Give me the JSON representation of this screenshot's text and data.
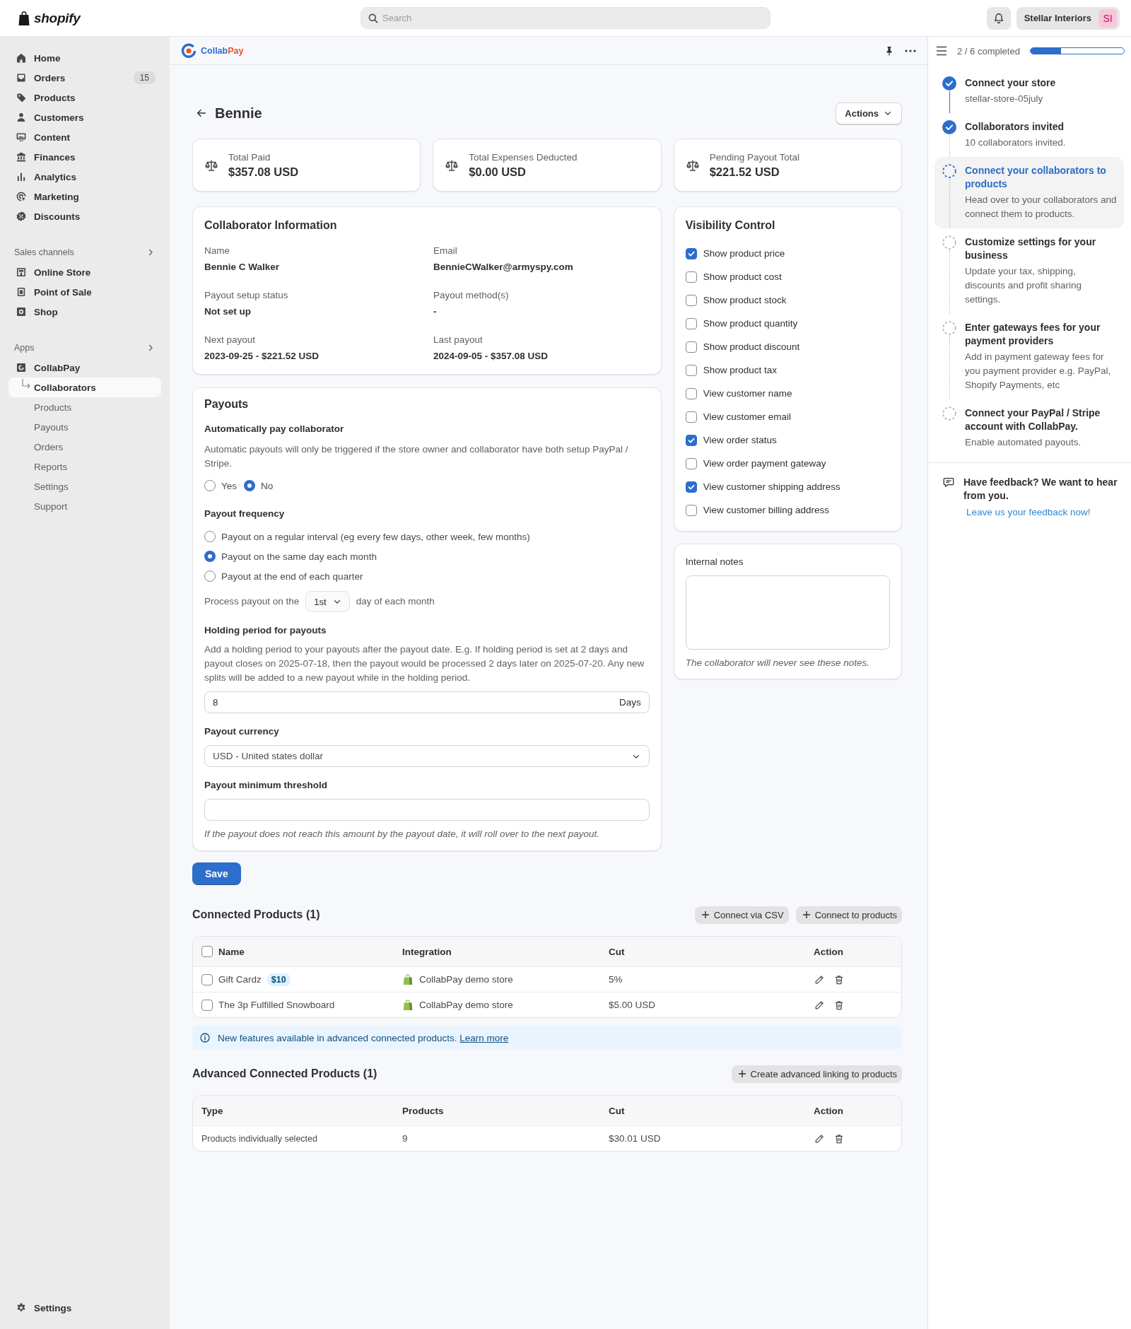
{
  "topbar": {
    "logo_text": "shopify",
    "search": {
      "placeholder": "Search"
    },
    "store": {
      "name": "Stellar Interiors",
      "initials": "SI"
    }
  },
  "sidebar": {
    "items": [
      {
        "label": "Home",
        "selected": false
      },
      {
        "label": "Orders",
        "badge": "15",
        "selected": false
      },
      {
        "label": "Products",
        "selected": false
      },
      {
        "label": "Customers",
        "selected": false
      },
      {
        "label": "Content",
        "selected": false
      },
      {
        "label": "Finances",
        "selected": false
      },
      {
        "label": "Analytics",
        "selected": false
      },
      {
        "label": "Marketing",
        "selected": false
      },
      {
        "label": "Discounts",
        "selected": false
      }
    ],
    "sales_channels": {
      "title": "Sales channels",
      "items": [
        {
          "label": "Online Store",
          "selected": false
        },
        {
          "label": "Point of Sale",
          "selected": false
        },
        {
          "label": "Shop",
          "selected": false
        }
      ]
    },
    "apps": {
      "title": "Apps",
      "items": [
        {
          "label": "CollabPay",
          "selected": false,
          "children": [
            {
              "label": "Collaborators",
              "selected": true
            },
            {
              "label": "Products",
              "selected": false
            },
            {
              "label": "Payouts",
              "selected": false
            },
            {
              "label": "Orders",
              "selected": false
            },
            {
              "label": "Reports",
              "selected": false
            },
            {
              "label": "Settings",
              "selected": false
            },
            {
              "label": "Support",
              "selected": false
            }
          ]
        }
      ]
    },
    "settings": {
      "label": "Settings"
    }
  },
  "app_header": {
    "brand": [
      "Collab",
      "Pay"
    ]
  },
  "page": {
    "title": "Bennie",
    "actions_button": "Actions",
    "stats": [
      {
        "label": "Total Paid",
        "value": "$357.08 USD"
      },
      {
        "label": "Total Expenses Deducted",
        "value": "$0.00 USD"
      },
      {
        "label": "Pending Payout Total",
        "value": "$221.52 USD"
      }
    ],
    "collaborator_info": {
      "title": "Collaborator Information",
      "fields": [
        {
          "label": "Name",
          "value": "Bennie C Walker"
        },
        {
          "label": "Email",
          "value": "BennieCWalker@armyspy.com"
        },
        {
          "label": "Payout setup status",
          "value": "Not set up"
        },
        {
          "label": "Payout method(s)",
          "value": "-"
        },
        {
          "label": "Next payout",
          "value": "2023-09-25 - $221.52 USD"
        },
        {
          "label": "Last payout",
          "value": "2024-09-05 - $357.08 USD"
        }
      ]
    },
    "payouts": {
      "title": "Payouts",
      "auto_pay": {
        "label": "Automatically pay collaborator",
        "help": "Automatic payouts will only be triggered if the store owner and collaborator have both setup PayPal / Stripe.",
        "options": [
          {
            "label": "Yes",
            "selected": false
          },
          {
            "label": "No",
            "selected": true
          }
        ]
      },
      "frequency": {
        "label": "Payout frequency",
        "options": [
          {
            "label": "Payout on a regular interval (eg every few days, other week, few months)",
            "selected": false
          },
          {
            "label": "Payout on the same day each month",
            "selected": true
          },
          {
            "label": "Payout at the end of each quarter",
            "selected": false
          }
        ],
        "process": {
          "prefix": "Process payout on the",
          "value": "1st",
          "suffix": "day of each month"
        }
      },
      "holding": {
        "label": "Holding period for payouts",
        "help": "Add a holding period to your payouts after the payout date. E.g. If holding period is set at 2 days and payout closes on 2025-07-18, then the payout would be processed 2 days later on 2025-07-20. Any new splits will be added to a new payout while in the holding period.",
        "value": "8",
        "unit": "Days"
      },
      "currency": {
        "label": "Payout currency",
        "value": "USD - United states dollar"
      },
      "threshold": {
        "label": "Payout minimum threshold",
        "help": "If the payout does not reach this amount by the payout date, it will roll over to the next payout."
      }
    },
    "save_button": "Save",
    "visibility": {
      "title": "Visibility Control",
      "options": [
        {
          "label": "Show product price",
          "checked": true
        },
        {
          "label": "Show product cost",
          "checked": false
        },
        {
          "label": "Show product stock",
          "checked": false
        },
        {
          "label": "Show product quantity",
          "checked": false
        },
        {
          "label": "Show product discount",
          "checked": false
        },
        {
          "label": "Show product tax",
          "checked": false
        },
        {
          "label": "View customer name",
          "checked": false
        },
        {
          "label": "View customer email",
          "checked": false
        },
        {
          "label": "View order status",
          "checked": true
        },
        {
          "label": "View order payment gateway",
          "checked": false
        },
        {
          "label": "View customer shipping address",
          "checked": true
        },
        {
          "label": "View customer billing address",
          "checked": false
        }
      ]
    },
    "internal_notes": {
      "label": "Internal notes",
      "help": "The collaborator will never see these notes."
    },
    "connected_products": {
      "title": "Connected Products (1)",
      "buttons": [
        "Connect via CSV",
        "Connect to products"
      ],
      "columns": [
        "Name",
        "Integration",
        "Cut",
        "Action"
      ],
      "select_all_checked": false,
      "rows": [
        {
          "checked": false,
          "name": "Gift Cardz",
          "badge": "$10",
          "integration": "CollabPay demo store",
          "cut": "5%"
        },
        {
          "checked": false,
          "name": "The 3p Fulfilled Snowboard",
          "integration": "CollabPay demo store",
          "cut": "$5.00 USD"
        }
      ]
    },
    "banner": {
      "text": "New features available in advanced connected products.",
      "link": "Learn more"
    },
    "advanced_products": {
      "title": "Advanced Connected Products (1)",
      "button": "Create advanced linking to products",
      "columns": [
        "Type",
        "Products",
        "Cut",
        "Action"
      ],
      "rows": [
        {
          "type": "Products individually selected",
          "products": "9",
          "cut": "$30.01 USD"
        }
      ]
    }
  },
  "right_panel": {
    "progress": {
      "text": "2 / 6 completed",
      "level": 0.33
    },
    "steps": [
      {
        "title": "Connect your store",
        "description": "stellar-store-05july",
        "done": true,
        "selected": false
      },
      {
        "title": "Collaborators invited",
        "description": "10 collaborators invited.",
        "done": true,
        "selected": false
      },
      {
        "title": "Connect your collaborators to products",
        "description": "Head over to your collaborators and connect them to products.",
        "done": false,
        "selected": true
      },
      {
        "title": "Customize settings for your business",
        "description": "Update your tax, shipping, discounts and profit sharing settings.",
        "done": false,
        "selected": false
      },
      {
        "title": "Enter gateways fees for your payment providers",
        "description": "Add in payment gateway fees for you payment provider e.g. PayPal, Shopify Payments, etc",
        "done": false,
        "selected": false
      },
      {
        "title": "Connect your PayPal / Stripe account with CollabPay.",
        "description": "Enable automated payouts.",
        "done": false,
        "selected": false
      }
    ],
    "feedback": {
      "title": "Have feedback? We want to hear from you.",
      "link": "Leave us your feedback now!"
    }
  }
}
